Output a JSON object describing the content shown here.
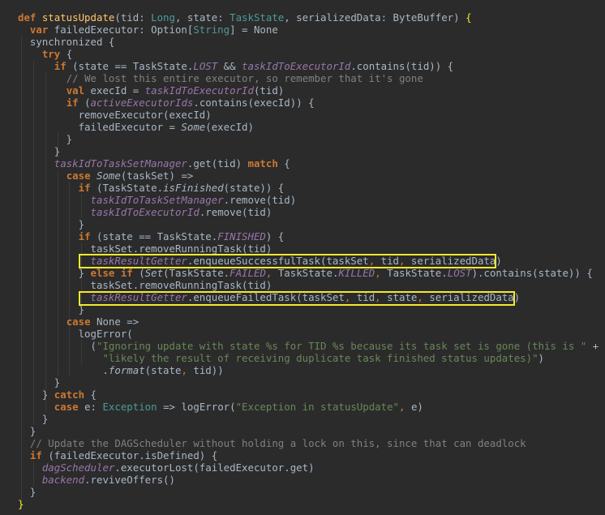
{
  "editor": {
    "language": "Scala",
    "highlight_color": "#f3e92b",
    "background": "#2b2b2b",
    "lines": [
      [
        {
          "t": "def ",
          "k": "kw"
        },
        {
          "t": "statusUpdate",
          "k": "fn"
        },
        {
          "t": "(tid: "
        },
        {
          "t": "Long",
          "k": "teal"
        },
        {
          "t": ", state: "
        },
        {
          "t": "TaskState",
          "k": "teal"
        },
        {
          "t": ", serializedData: ByteBuffer) "
        },
        {
          "t": "{",
          "k": "brace"
        }
      ],
      [
        {
          "t": "  "
        },
        {
          "t": "var ",
          "k": "kw"
        },
        {
          "t": "failedExecutor: Option["
        },
        {
          "t": "String",
          "k": "teal"
        },
        {
          "t": "] = None"
        }
      ],
      [
        {
          "t": "  synchronized {"
        }
      ],
      [
        {
          "t": "    "
        },
        {
          "t": "try ",
          "k": "kw"
        },
        {
          "t": "{"
        }
      ],
      [
        {
          "t": "      "
        },
        {
          "t": "if ",
          "k": "kw"
        },
        {
          "t": "(state == TaskState."
        },
        {
          "t": "LOST",
          "k": "const"
        },
        {
          "t": " && "
        },
        {
          "t": "taskIdToExecutorId",
          "k": "field"
        },
        {
          "t": ".contains(tid)) {"
        }
      ],
      [
        {
          "t": "        "
        },
        {
          "t": "// We lost this entire executor, so remember that it's gone",
          "k": "cmt"
        }
      ],
      [
        {
          "t": "        "
        },
        {
          "t": "val ",
          "k": "kw"
        },
        {
          "t": "execId = "
        },
        {
          "t": "taskIdToExecutorId",
          "k": "field"
        },
        {
          "t": "(tid)"
        }
      ],
      [
        {
          "t": "        "
        },
        {
          "t": "if ",
          "k": "kw"
        },
        {
          "t": "("
        },
        {
          "t": "activeExecutorIds",
          "k": "field"
        },
        {
          "t": ".contains(execId)) {"
        }
      ],
      [
        {
          "t": "          removeExecutor(execId)"
        }
      ],
      [
        {
          "t": "          failedExecutor = "
        },
        {
          "t": "Some",
          "k": "it"
        },
        {
          "t": "(execId)"
        }
      ],
      [
        {
          "t": "        }"
        }
      ],
      [
        {
          "t": "      }"
        }
      ],
      [
        {
          "t": "      "
        },
        {
          "t": "taskIdToTaskSetManager",
          "k": "field"
        },
        {
          "t": ".get(tid) "
        },
        {
          "t": "match ",
          "k": "kw"
        },
        {
          "t": "{"
        }
      ],
      [
        {
          "t": "        "
        },
        {
          "t": "case ",
          "k": "kw"
        },
        {
          "t": "Some",
          "k": "it"
        },
        {
          "t": "(taskSet) =>"
        }
      ],
      [
        {
          "t": "          "
        },
        {
          "t": "if ",
          "k": "kw"
        },
        {
          "t": "(TaskState."
        },
        {
          "t": "isFinished",
          "k": "it"
        },
        {
          "t": "(state)) {"
        }
      ],
      [
        {
          "t": "            "
        },
        {
          "t": "taskIdToTaskSetManager",
          "k": "field"
        },
        {
          "t": ".remove(tid)"
        }
      ],
      [
        {
          "t": "            "
        },
        {
          "t": "taskIdToExecutorId",
          "k": "field"
        },
        {
          "t": ".remove(tid)"
        }
      ],
      [
        {
          "t": "          }"
        }
      ],
      [
        {
          "t": "          "
        },
        {
          "t": "if ",
          "k": "kw"
        },
        {
          "t": "(state == TaskState."
        },
        {
          "t": "FINISHED",
          "k": "const"
        },
        {
          "t": ") {"
        }
      ],
      [
        {
          "t": "            taskSet.removeRunningTask(tid)"
        }
      ],
      [
        {
          "t": "            "
        },
        {
          "t": "taskResultGetter",
          "k": "field"
        },
        {
          "t": ".enqueueSuccessfulTask(taskSet"
        },
        {
          "t": ", ",
          "k": "punc"
        },
        {
          "t": "tid"
        },
        {
          "t": ", ",
          "k": "punc"
        },
        {
          "t": "serializedData)"
        }
      ],
      [
        {
          "t": "          } "
        },
        {
          "t": "else if ",
          "k": "kw"
        },
        {
          "t": "("
        },
        {
          "t": "Set",
          "k": "it"
        },
        {
          "t": "(TaskState."
        },
        {
          "t": "FAILED",
          "k": "const"
        },
        {
          "t": ", ",
          "k": "punc"
        },
        {
          "t": "TaskState."
        },
        {
          "t": "KILLED",
          "k": "const"
        },
        {
          "t": ", ",
          "k": "punc"
        },
        {
          "t": "TaskState."
        },
        {
          "t": "LOST",
          "k": "const"
        },
        {
          "t": ").contains(state)) {"
        }
      ],
      [
        {
          "t": "            taskSet.removeRunningTask(tid)"
        }
      ],
      [
        {
          "t": "            "
        },
        {
          "t": "taskResultGetter",
          "k": "field"
        },
        {
          "t": ".enqueueFailedTask(taskSet"
        },
        {
          "t": ", ",
          "k": "punc"
        },
        {
          "t": "tid"
        },
        {
          "t": ", ",
          "k": "punc"
        },
        {
          "t": "state"
        },
        {
          "t": ", ",
          "k": "punc"
        },
        {
          "t": "serializedData)"
        }
      ],
      [
        {
          "t": "          }"
        }
      ],
      [
        {
          "t": "        "
        },
        {
          "t": "case ",
          "k": "kw"
        },
        {
          "t": "None =>"
        }
      ],
      [
        {
          "t": "          logError("
        }
      ],
      [
        {
          "t": "            ("
        },
        {
          "t": "\"Ignoring update with state %s for TID %s because its task set is gone (this is \"",
          "k": "str"
        },
        {
          "t": " +"
        }
      ],
      [
        {
          "t": "              "
        },
        {
          "t": "\"likely the result of receiving duplicate task finished status updates)\"",
          "k": "str"
        },
        {
          "t": ")"
        }
      ],
      [
        {
          "t": "              ."
        },
        {
          "t": "format",
          "k": "it"
        },
        {
          "t": "(state"
        },
        {
          "t": ", ",
          "k": "punc"
        },
        {
          "t": "tid))"
        }
      ],
      [
        {
          "t": "      }"
        }
      ],
      [
        {
          "t": "    } "
        },
        {
          "t": "catch ",
          "k": "kw"
        },
        {
          "t": "{"
        }
      ],
      [
        {
          "t": "      "
        },
        {
          "t": "case ",
          "k": "kw"
        },
        {
          "t": "e: "
        },
        {
          "t": "Exception",
          "k": "teal"
        },
        {
          "t": " => logError("
        },
        {
          "t": "\"Exception in statusUpdate\"",
          "k": "str"
        },
        {
          "t": ", ",
          "k": "punc"
        },
        {
          "t": "e)"
        }
      ],
      [
        {
          "t": "    }"
        }
      ],
      [
        {
          "t": "  }"
        }
      ],
      [
        {
          "t": "  "
        },
        {
          "t": "// Update the DAGScheduler without holding a lock on this, since that can deadlock",
          "k": "cmt"
        }
      ],
      [
        {
          "t": "  "
        },
        {
          "t": "if ",
          "k": "kw"
        },
        {
          "t": "(failedExecutor.isDefined) {"
        }
      ],
      [
        {
          "t": "    "
        },
        {
          "t": "dagScheduler",
          "k": "field"
        },
        {
          "t": ".executorLost(failedExecutor.get)"
        }
      ],
      [
        {
          "t": "    "
        },
        {
          "t": "backend",
          "k": "field"
        },
        {
          "t": ".reviveOffers()"
        }
      ],
      [
        {
          "t": "  }"
        }
      ],
      [
        {
          "t": "}",
          "k": "brace"
        }
      ]
    ]
  }
}
